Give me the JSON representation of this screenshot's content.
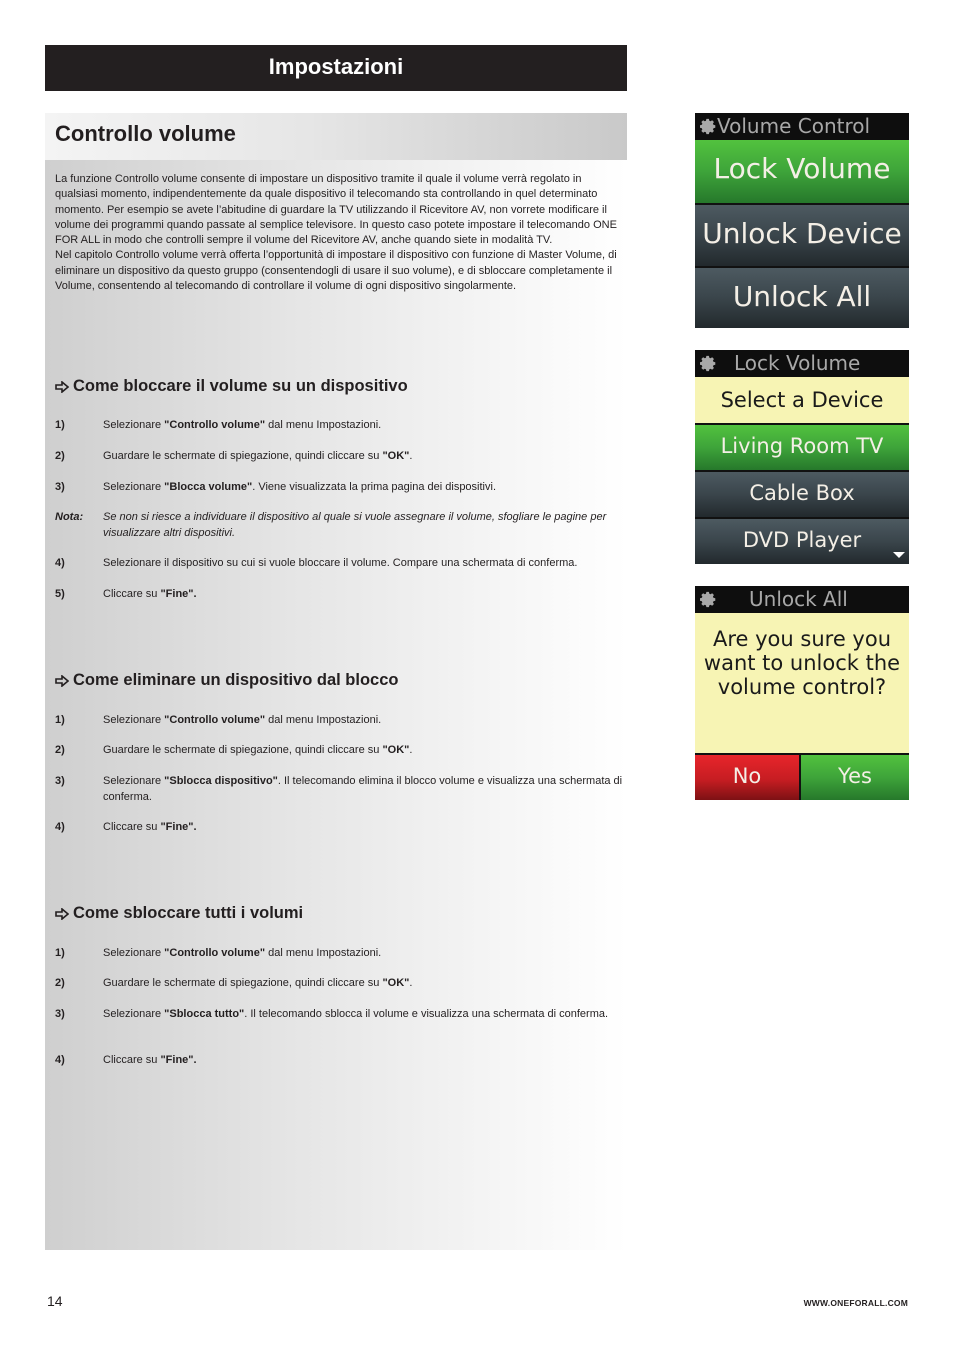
{
  "header": {
    "title": "Impostazioni"
  },
  "section": {
    "title": "Controllo volume",
    "intro": [
      "La funzione Controllo volume consente di impostare un dispositivo tramite il quale il volume verrà regolato in qualsiasi momento, indipendentemente da quale dispositivo il telecomando sta controllando in quel determinato momento. Per esempio se avete l’abitudine di guardare la TV utilizzando il Ricevitore AV, non vorrete modificare il volume dei programmi quando passate al semplice televisore. In questo caso potete impostare il telecomando ONE FOR ALL in modo che controlli sempre il volume del Ricevitore AV, anche quando siete in modalità TV.",
      "Nel capitolo Controllo volume verrà offerta l’opportunità di impostare il dispositivo con funzione di Master Volume, di eliminare un dispositivo da questo gruppo (consentendogli di usare il suo volume), e di sbloccare completamente il Volume, consentendo al telecomando di controllare il volume di ogni dispositivo singolarmente."
    ]
  },
  "procedures": [
    {
      "heading": "Come bloccare il volume su un dispositivo",
      "steps": [
        {
          "num": "1)",
          "pre": "Selezionare ",
          "bold": "\"Controllo volume\"",
          "post": " dal menu Impostazioni."
        },
        {
          "num": "2)",
          "pre": "Guardare le schermate di spiegazione, quindi cliccare su ",
          "bold": "\"OK\"",
          "post": "."
        },
        {
          "num": "3)",
          "pre": "Selezionare ",
          "bold": "\"Blocca volume\"",
          "post": ". Viene visualizzata la prima pagina dei dispositivi."
        },
        {
          "num": "Nota:",
          "pre": "Se non si riesce a individuare il dispositivo al quale si vuole assegnare il volume, sfogliare le pagine per visualizzare altri dispositivi.",
          "bold": "",
          "post": ""
        },
        {
          "num": "4)",
          "pre": "Selezionare il dispositivo su cui si vuole bloccare il volume. Compare una schermata di conferma.",
          "bold": "",
          "post": ""
        },
        {
          "num": "5)",
          "pre": "Cliccare su ",
          "bold": "\"Fine\".",
          "post": ""
        }
      ]
    },
    {
      "heading": "Come eliminare un dispositivo dal blocco",
      "steps": [
        {
          "num": "1)",
          "pre": "Selezionare ",
          "bold": "\"Controllo volume\"",
          "post": " dal menu Impostazioni."
        },
        {
          "num": "2)",
          "pre": "Guardare le schermate di spiegazione, quindi cliccare su ",
          "bold": "\"OK\"",
          "post": "."
        },
        {
          "num": "3)",
          "pre": "Selezionare ",
          "bold": "\"Sblocca dispositivo\"",
          "post": ". Il telecomando elimina il blocco volume e visualizza una schermata di conferma."
        },
        {
          "num": "4)",
          "pre": "Cliccare su ",
          "bold": "\"Fine\".",
          "post": ""
        }
      ]
    },
    {
      "heading": "Come sbloccare tutti i volumi",
      "steps": [
        {
          "num": "1)",
          "pre": "Selezionare ",
          "bold": "\"Controllo volume\"",
          "post": " dal menu Impostazioni."
        },
        {
          "num": "2)",
          "pre": "Guardare le schermate di spiegazione, quindi cliccare su ",
          "bold": "\"OK\"",
          "post": "."
        },
        {
          "num": "3)",
          "pre": "Selezionare ",
          "bold": "\"Sblocca tutto\"",
          "post": ". Il telecomando sblocca il volume e visualizza una schermata di conferma."
        },
        {
          "num": "4)",
          "pre": "Cliccare su ",
          "bold": "\"Fine\".",
          "post": ""
        }
      ]
    }
  ],
  "screens": {
    "volume_control": {
      "title": "Volume Control",
      "buttons": [
        "Lock Volume",
        "Unlock Device",
        "Unlock All"
      ]
    },
    "lock_volume": {
      "title": "Lock Volume",
      "prompt": "Select a Device",
      "devices": [
        "Living Room TV",
        "Cable Box",
        "DVD Player"
      ]
    },
    "unlock_all": {
      "title": "Unlock All",
      "message": "Are you sure you want to unlock the volume control?",
      "no_label": "No",
      "yes_label": "Yes"
    }
  },
  "colors": {
    "header_bg": "#231f20",
    "green": "#3ea43a",
    "dark": "#3a454b",
    "red": "#c61d22",
    "yellow": "#f7f4b4"
  },
  "footer": {
    "page_number": "14",
    "url": "WWW.ONEFORALL.COM"
  }
}
